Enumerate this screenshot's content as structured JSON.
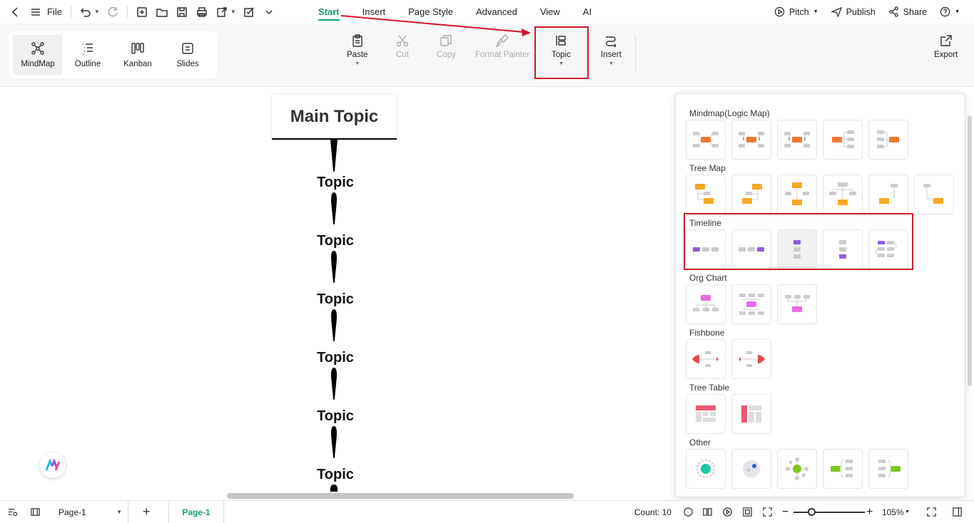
{
  "topbar": {
    "file_label": "File",
    "menu_tabs": [
      "Start",
      "Insert",
      "Page Style",
      "Advanced",
      "View",
      "AI"
    ],
    "active_tab": "Start",
    "pitch_label": "Pitch",
    "publish_label": "Publish",
    "share_label": "Share"
  },
  "ribbon": {
    "views": [
      "MindMap",
      "Outline",
      "Kanban",
      "Slides"
    ],
    "active_view": "MindMap",
    "paste_label": "Paste",
    "cut_label": "Cut",
    "copy_label": "Copy",
    "format_painter_label": "Format Painter",
    "topic_label": "Topic",
    "insert_label": "Insert",
    "export_label": "Export"
  },
  "canvas": {
    "main_topic": "Main Topic",
    "topics": [
      "Topic",
      "Topic",
      "Topic",
      "Topic",
      "Topic",
      "Topic"
    ]
  },
  "panel": {
    "sections": [
      {
        "title": "Mindmap(Logic Map)",
        "layouts": [
          "mindmap",
          "mindmap-updown",
          "mindmap-downup",
          "right-map",
          "left-map"
        ]
      },
      {
        "title": "Tree Map",
        "layouts": [
          "tree-right",
          "tree-left",
          "tree-both",
          "tree-down",
          "tree-up-left",
          "tree-up-right"
        ]
      },
      {
        "title": "Timeline",
        "layouts": [
          "timeline-horizontal",
          "timeline-horizontal-reverse",
          "timeline-vertical",
          "timeline-vertical-reverse",
          "timeline-winding"
        ]
      },
      {
        "title": "Org Chart",
        "layouts": [
          "org-down",
          "org-both",
          "org-up"
        ]
      },
      {
        "title": "Fishbone",
        "layouts": [
          "fishbone-left",
          "fishbone-right"
        ]
      },
      {
        "title": "Tree Table",
        "layouts": [
          "tree-table-horizontal",
          "tree-table-vertical"
        ]
      },
      {
        "title": "Other",
        "layouts": [
          "circle",
          "bubble",
          "sector",
          "bracket-right",
          "bracket-left"
        ]
      }
    ],
    "colors": {
      "mindmap": "#f07a32",
      "tree": "#f7a823",
      "timeline": "#8e5be0",
      "org": "#e86ce4",
      "fishbone": "#e44b4b",
      "table": "#e85a75",
      "other": "#7cc71d",
      "circle": "#1cc9a4"
    }
  },
  "status": {
    "page_select": "Page-1",
    "page_tab": "Page-1",
    "count": "Count: 10",
    "zoom": "105%"
  },
  "colors": {
    "accent": "#14a06e",
    "highlight": "#d0162a"
  }
}
